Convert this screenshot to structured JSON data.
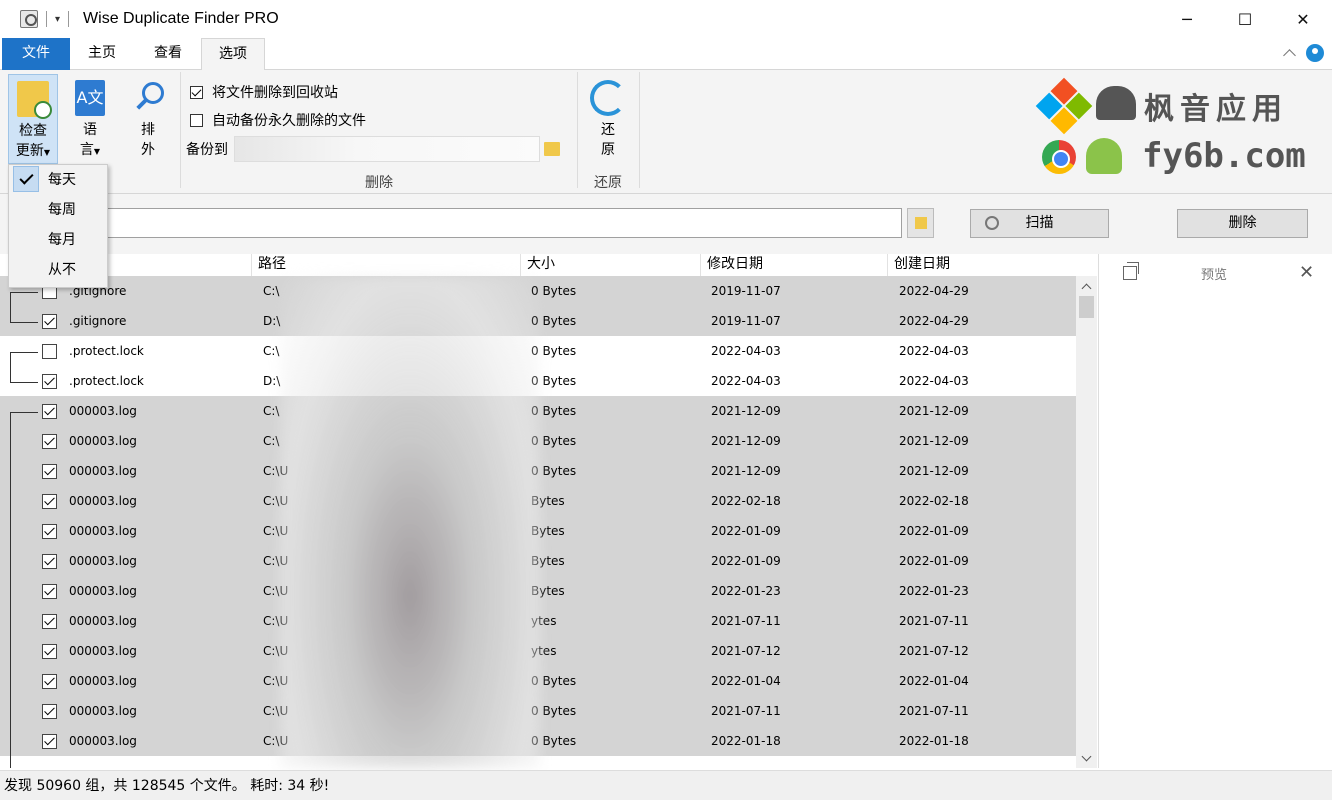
{
  "window": {
    "title": "Wise Duplicate Finder PRO",
    "quick_access": "▾",
    "minimize": "─",
    "maximize": "☐",
    "close": "✕"
  },
  "tabs": [
    {
      "label": "文件"
    },
    {
      "label": "主页"
    },
    {
      "label": "查看"
    },
    {
      "label": "选项"
    }
  ],
  "ribbon": {
    "check_update": {
      "line1": "检查",
      "line2": "更新"
    },
    "language": {
      "line1": "语",
      "line2": "言"
    },
    "exclude": {
      "line1": "排",
      "line2": "外"
    },
    "delete_to_recycle": "将文件删除到回收站",
    "auto_backup": "自动备份永久删除的文件",
    "backup_to": "备份到",
    "group_delete": "删除",
    "restore": {
      "line1": "还",
      "line2": "原"
    },
    "group_restore": "还原",
    "lang_icon_text": "A文"
  },
  "logo": {
    "name_cn": "枫音应用",
    "url": "fy6b.com"
  },
  "dropdown": {
    "items": [
      "每天",
      "每周",
      "每月",
      "从不"
    ],
    "selected": "每天"
  },
  "search": {
    "scan_label": "扫描",
    "delete_label": "删除"
  },
  "table": {
    "headers": {
      "path": "路径",
      "size": "大小",
      "modified": "修改日期",
      "created": "创建日期"
    },
    "rows": [
      {
        "checked": false,
        "name": ".gitignore",
        "path": "C:\\",
        "size": "0 Bytes",
        "modified": "2019-11-07",
        "created": "2022-04-29",
        "shade": "grey"
      },
      {
        "checked": true,
        "name": ".gitignore",
        "path": "D:\\",
        "size": "0 Bytes",
        "modified": "2019-11-07",
        "created": "2022-04-29",
        "shade": "grey"
      },
      {
        "checked": false,
        "name": ".protect.lock",
        "path": "C:\\",
        "size": "0 Bytes",
        "modified": "2022-04-03",
        "created": "2022-04-03",
        "shade": "white"
      },
      {
        "checked": true,
        "name": ".protect.lock",
        "path": "D:\\",
        "size": "0 Bytes",
        "modified": "2022-04-03",
        "created": "2022-04-03",
        "shade": "white"
      },
      {
        "checked": true,
        "name": "000003.log",
        "path": "C:\\",
        "size": "0 Bytes",
        "modified": "2021-12-09",
        "created": "2021-12-09",
        "shade": "grey"
      },
      {
        "checked": true,
        "name": "000003.log",
        "path": "C:\\",
        "size": "0 Bytes",
        "modified": "2021-12-09",
        "created": "2021-12-09",
        "shade": "grey"
      },
      {
        "checked": true,
        "name": "000003.log",
        "path": "C:\\U",
        "size": "0 Bytes",
        "modified": "2021-12-09",
        "created": "2021-12-09",
        "shade": "grey"
      },
      {
        "checked": true,
        "name": "000003.log",
        "path": "C:\\U",
        "size": "Bytes",
        "modified": "2022-02-18",
        "created": "2022-02-18",
        "shade": "grey"
      },
      {
        "checked": true,
        "name": "000003.log",
        "path": "C:\\U",
        "size": "Bytes",
        "modified": "2022-01-09",
        "created": "2022-01-09",
        "shade": "grey"
      },
      {
        "checked": true,
        "name": "000003.log",
        "path": "C:\\U",
        "size": "Bytes",
        "modified": "2022-01-09",
        "created": "2022-01-09",
        "shade": "grey"
      },
      {
        "checked": true,
        "name": "000003.log",
        "path": "C:\\U",
        "size": "Bytes",
        "modified": "2022-01-23",
        "created": "2022-01-23",
        "shade": "grey"
      },
      {
        "checked": true,
        "name": "000003.log",
        "path": "C:\\U",
        "size": "ytes",
        "modified": "2021-07-11",
        "created": "2021-07-11",
        "shade": "grey"
      },
      {
        "checked": true,
        "name": "000003.log",
        "path": "C:\\U",
        "size": "ytes",
        "modified": "2021-07-12",
        "created": "2021-07-12",
        "shade": "grey"
      },
      {
        "checked": true,
        "name": "000003.log",
        "path": "C:\\U",
        "size": "0 Bytes",
        "modified": "2022-01-04",
        "created": "2022-01-04",
        "shade": "grey"
      },
      {
        "checked": true,
        "name": "000003.log",
        "path": "C:\\U",
        "size": "0 Bytes",
        "modified": "2021-07-11",
        "created": "2021-07-11",
        "shade": "grey"
      },
      {
        "checked": true,
        "name": "000003.log",
        "path": "C:\\U",
        "size": "0 Bytes",
        "modified": "2022-01-18",
        "created": "2022-01-18",
        "shade": "grey"
      }
    ]
  },
  "preview": {
    "title": "预览",
    "close": "✕"
  },
  "status": "发现 50960 组，共 128545 个文件。 耗时: 34 秒!",
  "colors": {
    "accent": "#1e73c8",
    "row_grey": "#d4d4d4"
  }
}
